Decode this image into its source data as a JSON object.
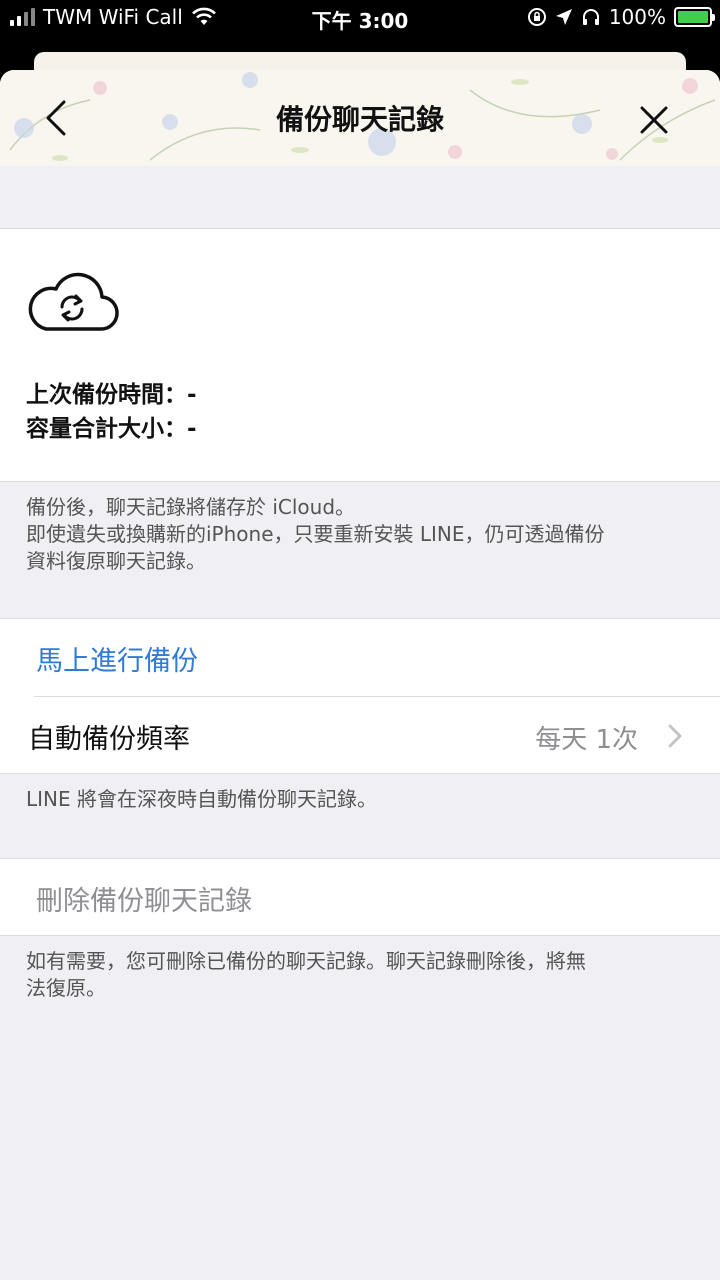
{
  "status_bar": {
    "carrier": "TWM WiFi Call",
    "time": "下午 3:00",
    "battery": "100%"
  },
  "nav": {
    "title": "備份聊天記錄",
    "back_icon": "chevron-left-icon",
    "close_icon": "close-icon"
  },
  "backup_info": {
    "icon": "cloud-sync-icon",
    "last_backup": "上次備份時間：-",
    "total_size": "容量合計大小：-"
  },
  "backup_note": {
    "line1": "備份後，聊天記錄將儲存於 iCloud。",
    "line2": "即使遺失或換購新的iPhone，只要重新安裝 LINE，仍可透過備份",
    "line3": "資料復原聊天記錄。"
  },
  "actions": {
    "backup_now": "馬上進行備份",
    "auto_backup_label": "自動備份頻率",
    "auto_backup_value": "每天 1次"
  },
  "auto_note": "LINE 將會在深夜時自動備份聊天記錄。",
  "delete": {
    "label": "刪除備份聊天記錄",
    "note_line1": "如有需要，您可刪除已備份的聊天記錄。聊天記錄刪除後，將無",
    "note_line2": "法復原。"
  },
  "colors": {
    "link_blue": "#2f7bd6",
    "grey_text": "#8e8e93",
    "background": "#efeff4"
  }
}
